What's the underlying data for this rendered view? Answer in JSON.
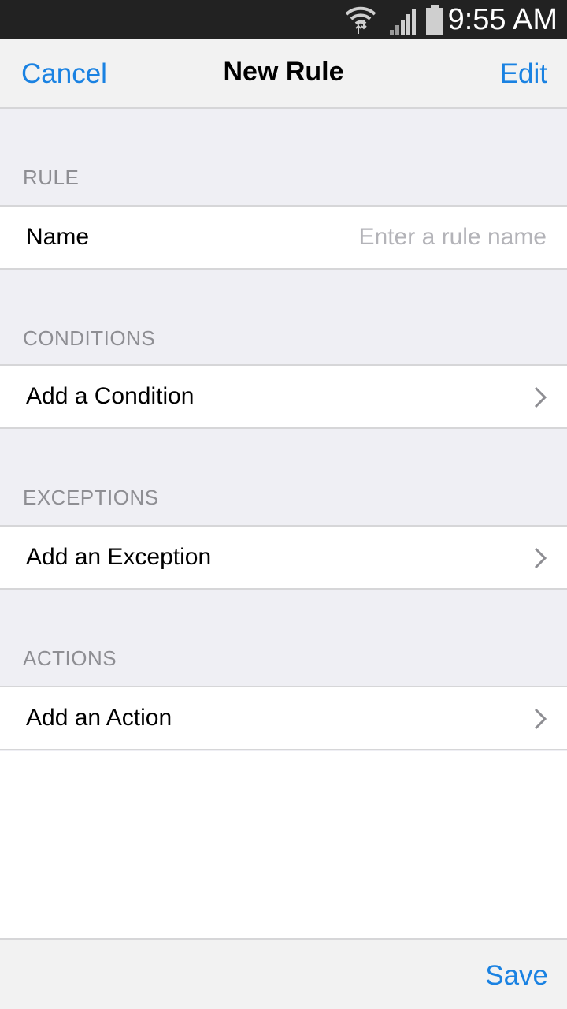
{
  "status_bar": {
    "time": "9:55 AM",
    "icons": [
      "wifi-icon",
      "signal-icon",
      "battery-icon"
    ]
  },
  "nav": {
    "cancel_label": "Cancel",
    "title": "New Rule",
    "edit_label": "Edit"
  },
  "sections": {
    "rule": {
      "header": "RULE",
      "name_label": "Name",
      "name_placeholder": "Enter a rule name",
      "name_value": ""
    },
    "conditions": {
      "header": "CONDITIONS",
      "row_label": "Add a Condition"
    },
    "exceptions": {
      "header": "EXCEPTIONS",
      "row_label": "Add an Exception"
    },
    "actions": {
      "header": "ACTIONS",
      "row_label": "Add an Action"
    }
  },
  "toolbar": {
    "save_label": "Save"
  },
  "colors": {
    "accent": "#1a82e2",
    "status_bar_bg": "#222222",
    "group_bg": "#efeff4",
    "header_text": "#8e8e93",
    "placeholder": "#b3b3b8",
    "separator": "#d6d6d8"
  }
}
